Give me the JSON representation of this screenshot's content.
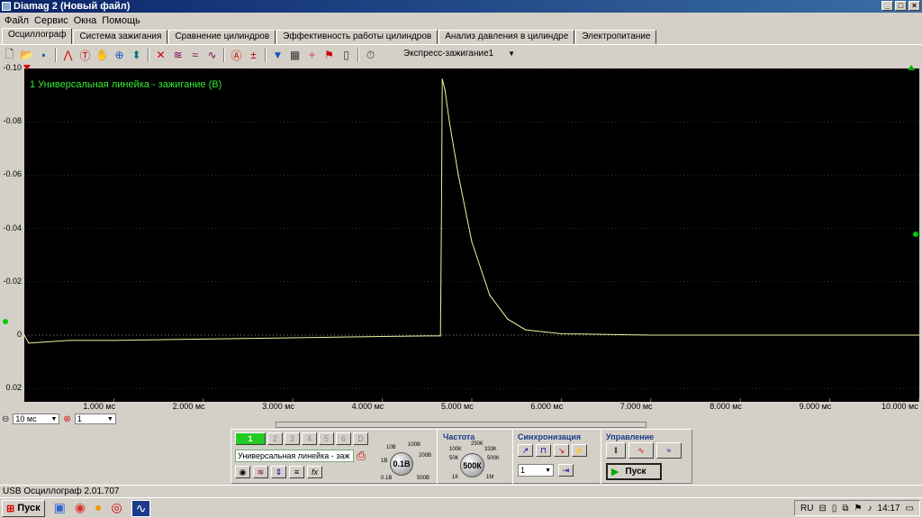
{
  "window": {
    "title": "Diamag 2 (Новый файл)",
    "min": "_",
    "max": "□",
    "close": "×"
  },
  "menu": [
    "Файл",
    "Сервис",
    "Окна",
    "Помощь"
  ],
  "tabs": [
    "Осциллограф",
    "Система зажигания",
    "Сравнение цилиндров",
    "Эффективность работы цилиндров",
    "Анализ давления в цилиндре",
    "Электропитание"
  ],
  "toolbar": {
    "mode_select": "Экспресс-зажигание1"
  },
  "scope": {
    "channel_title": "1 Универсальная линейка - зажигание (В)",
    "y_ticks": [
      "-0.10",
      "-0.08",
      "-0.06",
      "-0.04",
      "-0.02",
      "0",
      "0.02"
    ],
    "x_ticks": [
      "1.000 мс",
      "2.000 мс",
      "3.000 мс",
      "4.000 мс",
      "5.000 мс",
      "6.000 мс",
      "7.000 мс",
      "8.000 мс",
      "9.000 мс",
      "10.000 мс"
    ],
    "trace_color": "#f0f0a0"
  },
  "chart_data": {
    "type": "line",
    "title": "1 Универсальная линейка - зажигание (В)",
    "xlabel": "",
    "ylabel": "",
    "xlim": [
      0,
      10
    ],
    "ylim": [
      0.025,
      -0.1
    ],
    "x": [
      0,
      0.05,
      0.5,
      1.0,
      2.0,
      3.0,
      4.0,
      4.5,
      4.65,
      4.66,
      4.67,
      4.7,
      4.75,
      4.85,
      5.0,
      5.2,
      5.4,
      5.6,
      6.0,
      7.0,
      8.0,
      9.0,
      10.0
    ],
    "y": [
      0.0,
      0.003,
      0.002,
      0.002,
      0.0015,
      0.001,
      0.0005,
      0.0003,
      0.0003,
      -0.04,
      -0.096,
      -0.092,
      -0.08,
      -0.06,
      -0.035,
      -0.015,
      -0.006,
      -0.002,
      -0.0005,
      0.0,
      0.0,
      0.0,
      0.0
    ]
  },
  "bottom": {
    "timebase": "10 мс",
    "channel_sel": "1"
  },
  "panel": {
    "channel_buttons": [
      "1",
      "2",
      "3",
      "4",
      "5",
      "6",
      "D"
    ],
    "probe": "Универсальная линейка - заж",
    "volt_knob": "0.1В",
    "volt_marks": [
      "10В",
      "100В",
      "1В",
      "200В",
      "0.1В",
      "500В"
    ],
    "freq_title": "Частота",
    "freq_knob": "500К",
    "freq_marks": [
      "250К",
      "100К",
      "333К",
      "50К",
      "500К",
      "1К",
      "1М"
    ],
    "sync_title": "Синхронизация",
    "sync_channel": "1",
    "control_title": "Управление",
    "start_label": "Пуск"
  },
  "status": "USB Осциллограф  2.01.707",
  "taskbar": {
    "start": "Пуск",
    "lang": "RU",
    "time": "14:17"
  }
}
